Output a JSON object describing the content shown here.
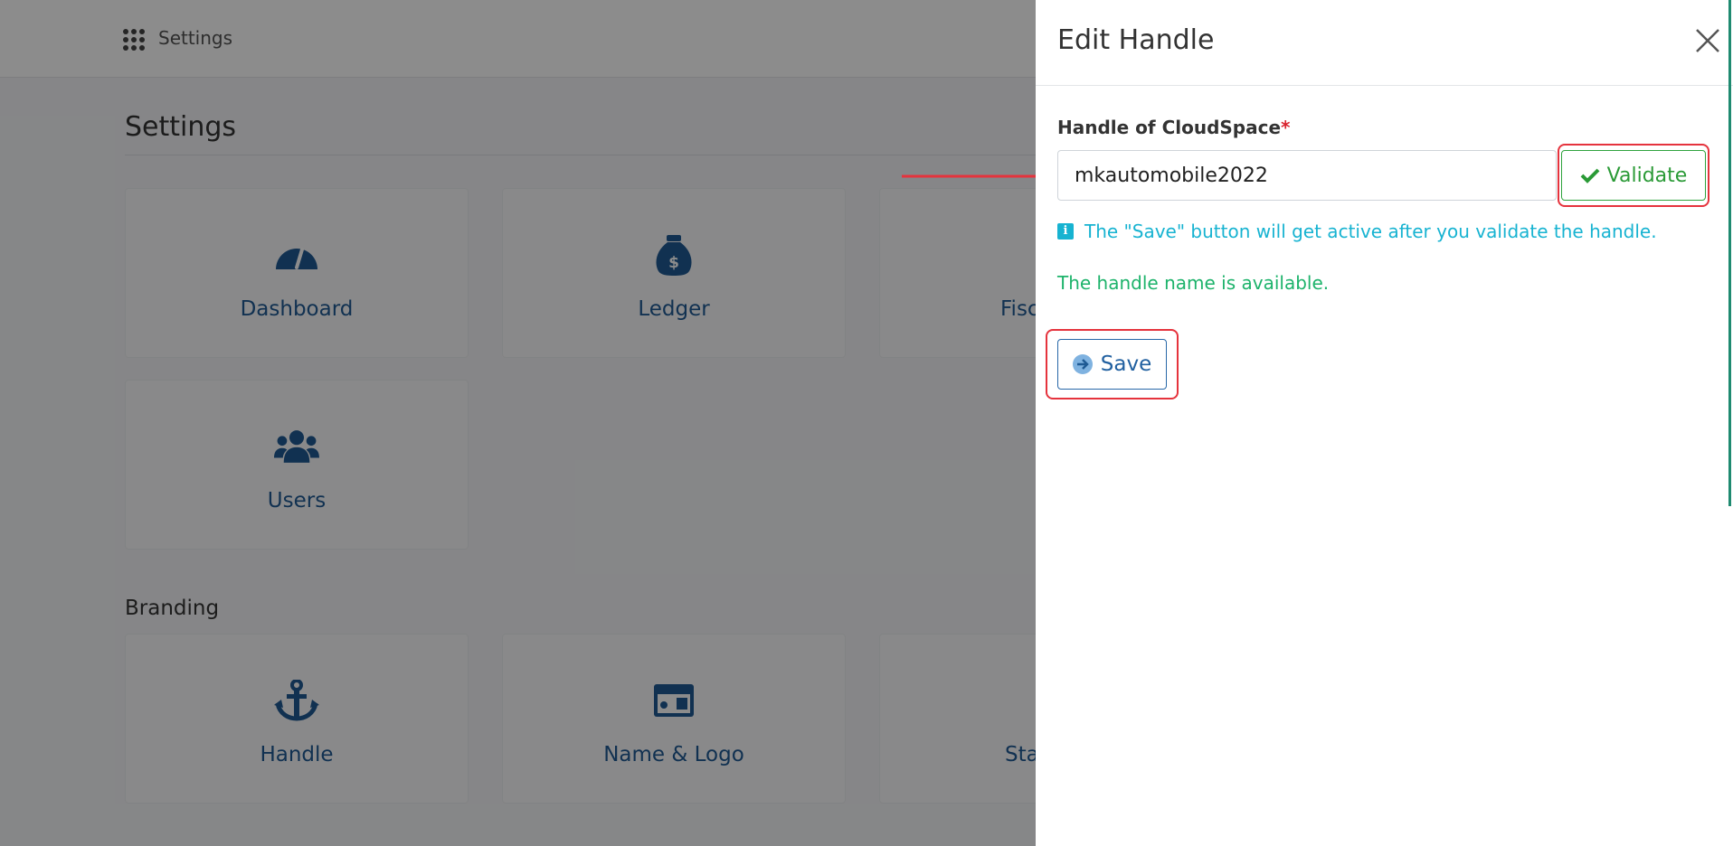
{
  "topbar": {
    "title": "Settings",
    "apps_icon": "grid-icon"
  },
  "page": {
    "title": "Settings"
  },
  "tiles_main": [
    {
      "label": "Dashboard",
      "icon": "gauge-icon"
    },
    {
      "label": "Ledger",
      "icon": "money-bag-icon"
    },
    {
      "label": "Fisc",
      "icon": "calendar-icon"
    },
    {
      "label": "Users",
      "icon": "users-icon"
    }
  ],
  "branding": {
    "title": "Branding",
    "tiles": [
      {
        "label": "Handle",
        "icon": "anchor-icon"
      },
      {
        "label": "Name & Logo",
        "icon": "id-card-icon"
      },
      {
        "label": "Sta",
        "icon": "card-icon"
      }
    ]
  },
  "drawer": {
    "title": "Edit Handle",
    "field_label": "Handle of CloudSpace",
    "required_mark": "*",
    "input_value": "mkautomobile2022",
    "validate_label": "Validate",
    "info_text": "The \"Save\" button will get active after you validate the handle.",
    "success_text": "The handle name is available.",
    "save_label": "Save"
  },
  "colors": {
    "brand_blue": "#1f5a94",
    "success_green": "#2a9a36",
    "info_cyan": "#17b3d1",
    "highlight_red": "#e5333d"
  }
}
